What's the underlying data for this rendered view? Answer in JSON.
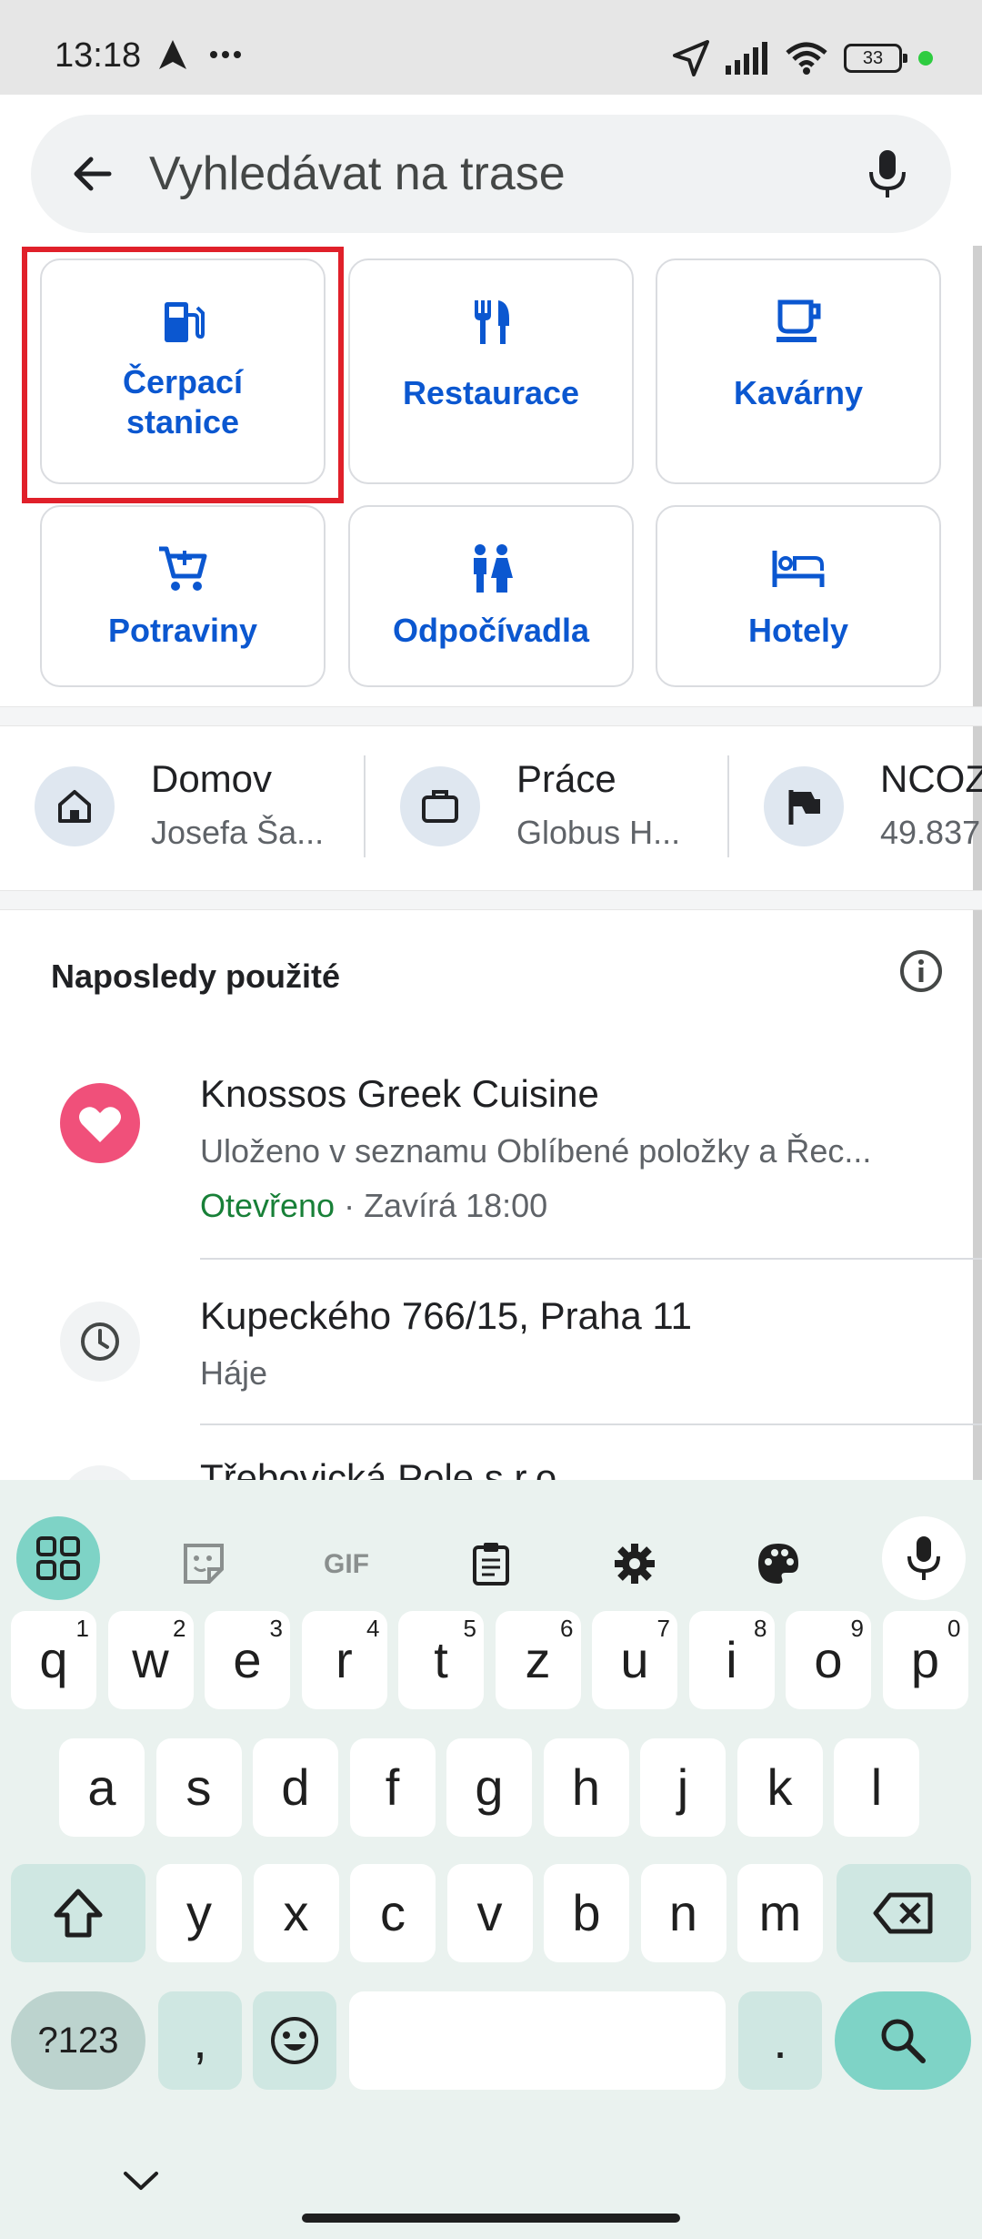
{
  "status_bar": {
    "time": "13:18",
    "battery": "33"
  },
  "search": {
    "placeholder": "Vyhledávat na trase"
  },
  "categories": [
    {
      "label_line1": "Čerpací",
      "label_line2": "stanice",
      "icon": "gas-station-icon"
    },
    {
      "label": "Restaurace",
      "icon": "restaurant-icon"
    },
    {
      "label": "Kavárny",
      "icon": "coffee-icon"
    },
    {
      "label": "Potraviny",
      "icon": "grocery-cart-icon"
    },
    {
      "label": "Odpočívadla",
      "icon": "restroom-icon"
    },
    {
      "label": "Hotely",
      "icon": "hotel-icon"
    }
  ],
  "shortcuts": [
    {
      "title": "Domov",
      "subtitle": "Josefa Ša...",
      "icon": "home-icon"
    },
    {
      "title": "Práce",
      "subtitle": "Globus H...",
      "icon": "briefcase-icon"
    },
    {
      "title": "NCOZ",
      "subtitle": "49.837",
      "icon": "flag-icon"
    }
  ],
  "recent": {
    "title": "Naposledy použité",
    "items": [
      {
        "title": "Knossos Greek Cuisine",
        "subtitle": "Uloženo v seznamu Oblíbené položky a Řec...",
        "status_open": "Otevřeno",
        "status_rest": " · Zavírá 18:00",
        "icon": "heart-icon"
      },
      {
        "title": "Kupeckého 766/15, Praha 11",
        "subtitle": "Háje",
        "icon": "history-icon"
      },
      {
        "title": "Třebovická Pole s.r.o.",
        "icon": "history-icon"
      }
    ]
  },
  "keyboard": {
    "row1": [
      {
        "key": "q",
        "hint": "1"
      },
      {
        "key": "w",
        "hint": "2"
      },
      {
        "key": "e",
        "hint": "3"
      },
      {
        "key": "r",
        "hint": "4"
      },
      {
        "key": "t",
        "hint": "5"
      },
      {
        "key": "z",
        "hint": "6"
      },
      {
        "key": "u",
        "hint": "7"
      },
      {
        "key": "i",
        "hint": "8"
      },
      {
        "key": "o",
        "hint": "9"
      },
      {
        "key": "p",
        "hint": "0"
      }
    ],
    "row2": [
      "a",
      "s",
      "d",
      "f",
      "g",
      "h",
      "j",
      "k",
      "l"
    ],
    "row3": [
      "y",
      "x",
      "c",
      "v",
      "b",
      "n",
      "m"
    ],
    "symbols_label": "?123",
    "comma": ",",
    "period": "."
  },
  "colors": {
    "accent": "#0b57d0",
    "highlight": "#e0202a",
    "open": "#188038",
    "heart": "#f0507a"
  }
}
